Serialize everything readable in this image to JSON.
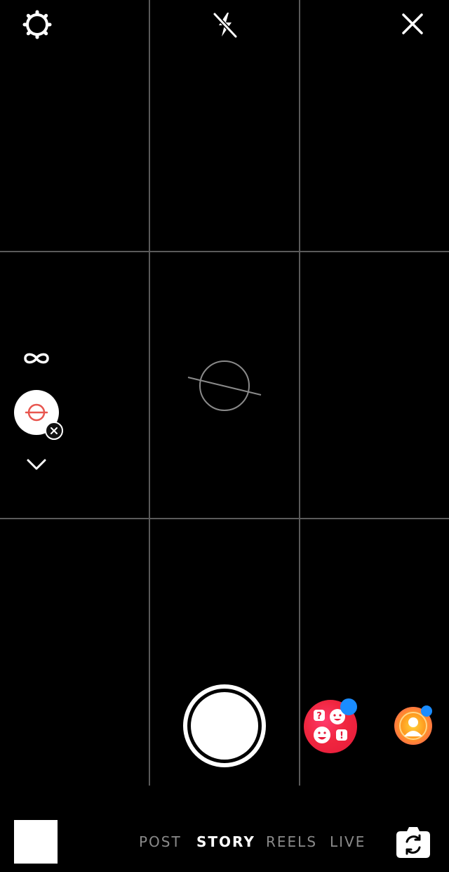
{
  "camera": {
    "settings_icon": "gear-icon",
    "flash_icon": "flash-off-icon",
    "close_icon": "close-icon"
  },
  "side_tools": {
    "boomerang_icon": "infinity-icon",
    "active_effect_icon": "level-effect-icon",
    "remove_effect_icon": "close-icon",
    "more_icon": "chevron-down-icon"
  },
  "capture": {
    "shutter_icon": "shutter-button",
    "effect_trays": [
      {
        "icon": "emoji-effects-icon",
        "has_new": true
      },
      {
        "icon": "face-effect-icon",
        "has_new": true
      }
    ]
  },
  "modes": {
    "tabs": [
      {
        "label": "POST",
        "active": false
      },
      {
        "label": "STORY",
        "active": true
      },
      {
        "label": "REELS",
        "active": false
      },
      {
        "label": "LIVE",
        "active": false
      }
    ]
  },
  "bottom": {
    "gallery_icon": "gallery-thumbnail",
    "flip_icon": "flip-camera-icon"
  },
  "colors": {
    "background": "#000000",
    "grid": "#5a5a5a",
    "inactive_tab": "#8a8a8a",
    "active_tab": "#ffffff",
    "new_badge": "#1a8cff",
    "effect_red": "#f0263f"
  }
}
